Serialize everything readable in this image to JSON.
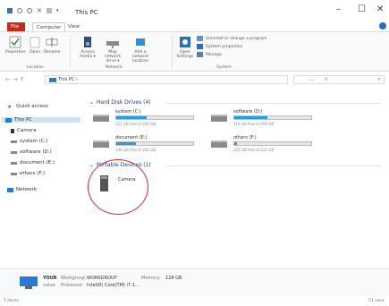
{
  "window": {
    "title": "This PC",
    "minimize_glyph": "–",
    "maximize_glyph": "☐",
    "close_glyph": "✕"
  },
  "quick_access_icons": [
    "properties-icon",
    "undo-icon",
    "redo-icon",
    "delete-icon",
    "checkmark-icon",
    "dropdown-icon"
  ],
  "tabs": [
    {
      "label": "File"
    },
    {
      "label": "Computer"
    },
    {
      "label": "View"
    }
  ],
  "ribbon": {
    "location": {
      "group_label": "Location",
      "buttons": [
        {
          "label": "Properties",
          "icon": "checkmark-icon"
        },
        {
          "label": "Open",
          "icon": "open-icon"
        },
        {
          "label": "Rename",
          "icon": "rename-icon"
        }
      ]
    },
    "network": {
      "group_label": "Network",
      "buttons": [
        {
          "label": "Access media ▾",
          "icon": "access-media-icon"
        },
        {
          "label": "Map network drive ▾",
          "icon": "map-drive-icon"
        },
        {
          "label": "Add a network location",
          "icon": "network-location-icon"
        }
      ]
    },
    "system": {
      "group_label": "System",
      "open_settings": "Open Settings",
      "uninstall": "Uninstall or change a program",
      "properties": "System properties",
      "manage": "Manage"
    }
  },
  "address_bar": {
    "path": "This PC ›",
    "dropdown_glyph": "⌄",
    "refresh_glyph": "↻",
    "search_glyph": "⌕"
  },
  "sidebar": {
    "items": [
      {
        "label": "Quick access",
        "icon": "star-icon"
      },
      {
        "label": "This PC",
        "icon": "computer-icon"
      },
      {
        "label": "Camera",
        "icon": "camera-icon"
      },
      {
        "label": "system (C:)",
        "icon": "drive-icon"
      },
      {
        "label": "software (D:)",
        "icon": "drive-icon"
      },
      {
        "label": "document (E:)",
        "icon": "drive-icon"
      },
      {
        "label": "others (F:)",
        "icon": "drive-icon"
      },
      {
        "label": "Network",
        "icon": "network-icon"
      }
    ]
  },
  "hard_disk_section": {
    "heading": "Hard Disk Drives (4)",
    "drives": [
      {
        "name": "system (C:)",
        "free_text": "121 GB free of 200 GB",
        "used_fraction": 0.4
      },
      {
        "name": "software (D:)",
        "free_text": "114 GB free of 200 GB",
        "used_fraction": 0.43
      },
      {
        "name": "document (E:)",
        "free_text": "149 GB free of 200 GB",
        "used_fraction": 0.26
      },
      {
        "name": "others (F:)",
        "free_text": "225 GB free of 231 GB",
        "used_fraction": 0.03
      }
    ]
  },
  "portable_section": {
    "heading": "Portable Devices (1)",
    "devices": [
      {
        "name": "Camera",
        "icon": "camera-icon"
      }
    ]
  },
  "details_pane": {
    "computer_name": "YOUR",
    "workgroup_label": "Workgroup:",
    "workgroup_value": "WORKGROUP",
    "memory_label": "Memory:",
    "memory_value": "128 GB",
    "processor_label": "Processor:",
    "processor_value": "Intel(R) Core(TM) i7-1...",
    "domain_label": "value"
  },
  "status_bar": {
    "item_count": "5 items",
    "right_text": "51 seco"
  },
  "colors": {
    "accent": "#26a0da",
    "file_tab": "#c8291e",
    "link_blue": "#1e3c87",
    "annotation_circle": "#cf2a2a"
  }
}
